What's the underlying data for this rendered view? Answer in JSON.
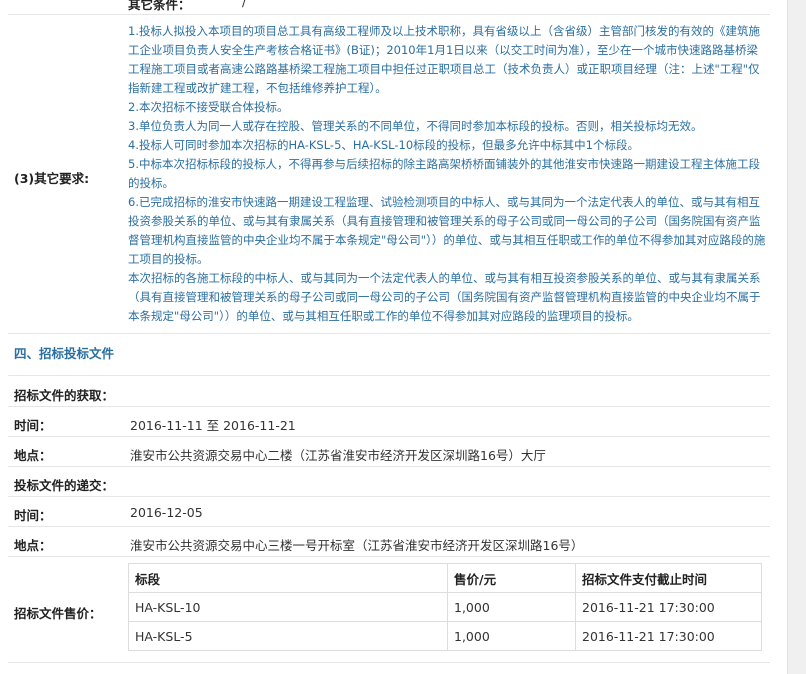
{
  "top_label": "其它条件：",
  "top_value": "/",
  "other_requirements": {
    "label": "(3)其它要求:",
    "paragraphs": [
      "1.投标人拟投入本项目的项目总工具有高级工程师及以上技术职称，具有省级以上（含省级）主管部门核发的有效的《建筑施工企业项目负责人安全生产考核合格证书》(B证)；2010年1月1日以来（以交工时间为准），至少在一个城市快速路路基桥梁工程施工项目或者高速公路路基桥梁工程施工项目中担任过正职项目总工（技术负责人）或正职项目经理（注：上述\"工程\"仅指新建工程或改扩建工程，不包括维修养护工程）。",
      "2.本次招标不接受联合体投标。",
      "3.单位负责人为同一人或存在控股、管理关系的不同单位，不得同时参加本标段的投标。否则，相关投标均无效。",
      "4.投标人可同时参加本次招标的HA-KSL-5、HA-KSL-10标段的投标，但最多允许中标其中1个标段。",
      "5.中标本次招标标段的投标人，不得再参与后续招标的除主路高架桥桥面铺装外的其他淮安市快速路一期建设工程主体施工段的投标。",
      "6.已完成招标的淮安市快速路一期建设工程监理、试验检测项目的中标人、或与其同为一个法定代表人的单位、或与其有相互投资参股关系的单位、或与其有隶属关系（具有直接管理和被管理关系的母子公司或同一母公司的子公司（国务院国有资产监督管理机构直接监管的中央企业均不属于本条规定\"母公司\"））的单位、或与其相互任职或工作的单位不得参加其对应路段的施工项目的投标。",
      "本次招标的各施工标段的中标人、或与其同为一个法定代表人的单位、或与其有相互投资参股关系的单位、或与其有隶属关系（具有直接管理和被管理关系的母子公司或同一母公司的子公司（国务院国有资产监督管理机构直接监管的中央企业均不属于本条规定\"母公司\"））的单位、或与其相互任职或工作的单位不得参加其对应路段的监理项目的投标。"
    ]
  },
  "section4": {
    "title": "四、招标投标文件",
    "acquisition_label": "招标文件的获取：",
    "time_label": "时间：",
    "time_value": "2016-11-11 至 2016-11-21",
    "place_label": "地点：",
    "place_value": "淮安市公共资源交易中心二楼（江苏省淮安市经济开发区深圳路16号）大厅",
    "submission_label": "投标文件的递交：",
    "submit_time_label": "时间：",
    "submit_time_value": "2016-12-05",
    "submit_place_label": "地点：",
    "submit_place_value": "淮安市公共资源交易中心三楼一号开标室（江苏省淮安市经济开发区深圳路16号）",
    "price_label": "招标文件售价：",
    "price_table": {
      "headers": [
        "标段",
        "售价/元",
        "招标文件支付截止时间"
      ],
      "rows": [
        [
          "HA-KSL-10",
          "1,000",
          "2016-11-21 17:30:00"
        ],
        [
          "HA-KSL-5",
          "1,000",
          "2016-11-21 17:30:00"
        ]
      ]
    }
  }
}
